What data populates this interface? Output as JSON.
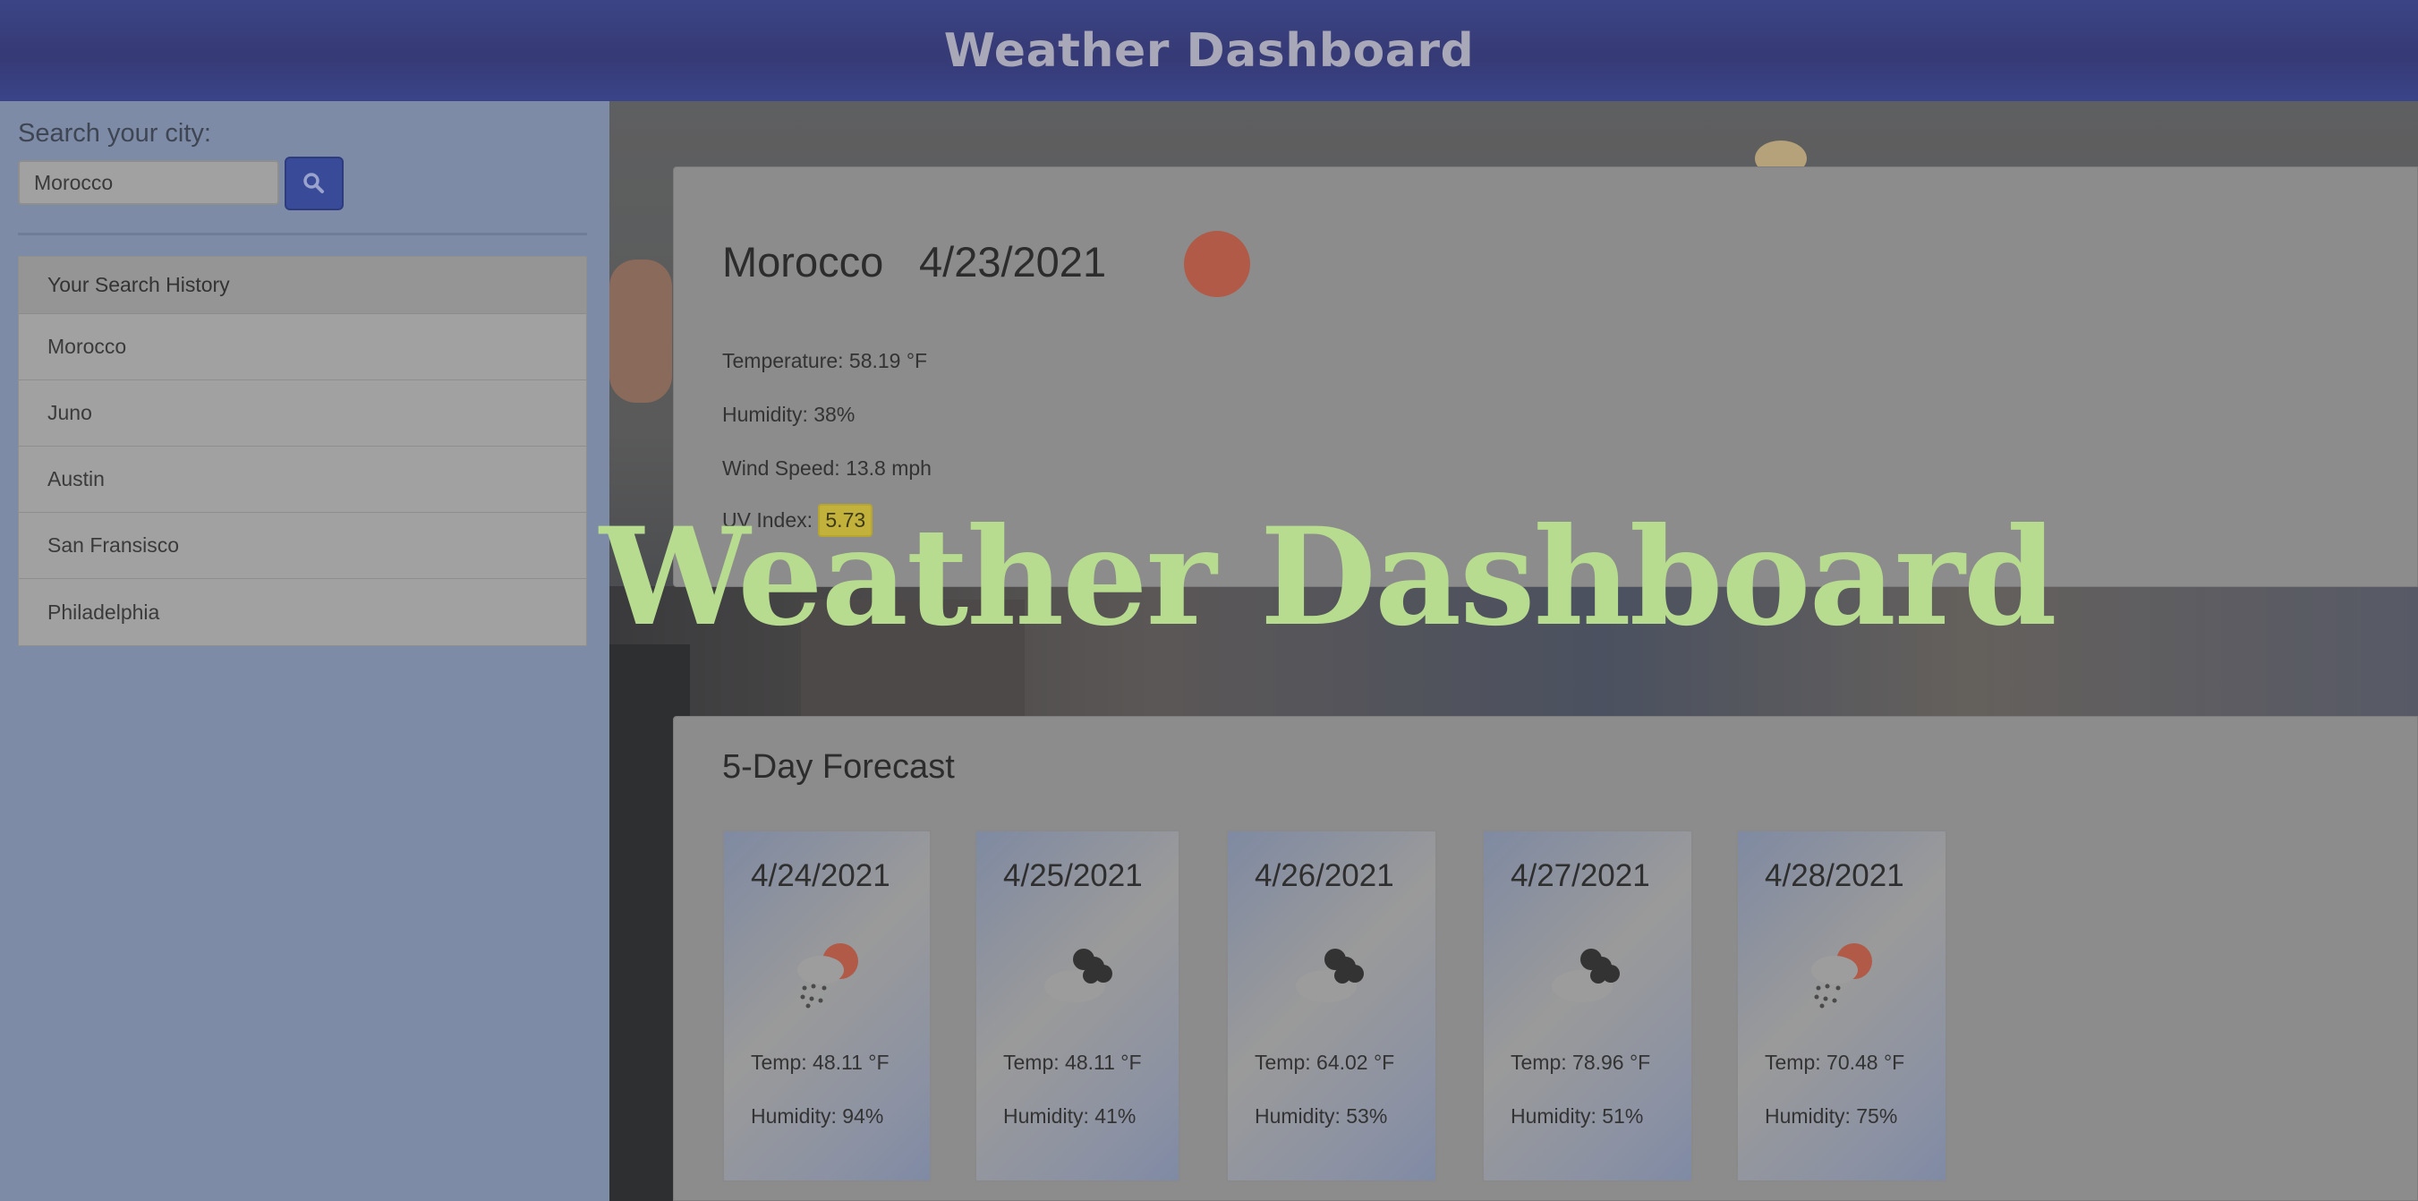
{
  "header": {
    "title": "Weather Dashboard"
  },
  "sidebar": {
    "search_label": "Search your city:",
    "search_value": "Morocco",
    "search_icon": "search-icon",
    "history_title": "Your Search History",
    "history": [
      "Morocco",
      "Juno",
      "Austin",
      "San Fransisco",
      "Philadelphia"
    ]
  },
  "current": {
    "city": "Morocco",
    "date": "4/23/2021",
    "icon": "sun-icon",
    "temperature": "Temperature: 58.19 °F",
    "humidity": "Humidity: 38%",
    "wind": "Wind Speed: 13.8 mph",
    "uv_label": "UV Index:",
    "uv_value": "5.73"
  },
  "forecast": {
    "title": "5-Day Forecast",
    "days": [
      {
        "date": "4/24/2021",
        "icon": "sun-rain-icon",
        "temp": "Temp: 48.11 °F",
        "humidity": "Humidity: 94%"
      },
      {
        "date": "4/25/2021",
        "icon": "dark-clouds-icon",
        "temp": "Temp: 48.11 °F",
        "humidity": "Humidity: 41%"
      },
      {
        "date": "4/26/2021",
        "icon": "dark-clouds-icon",
        "temp": "Temp: 64.02 °F",
        "humidity": "Humidity: 53%"
      },
      {
        "date": "4/27/2021",
        "icon": "dark-clouds-icon",
        "temp": "Temp: 78.96 °F",
        "humidity": "Humidity: 51%"
      },
      {
        "date": "4/28/2021",
        "icon": "sun-rain-icon",
        "temp": "Temp: 70.48 °F",
        "humidity": "Humidity: 75%"
      }
    ]
  },
  "overlay": {
    "title": "Weather Dashboard"
  },
  "colors": {
    "header": "#363a75",
    "sidebar": "#7d8ba6",
    "accent_button": "#384a98",
    "uv_badge": "#c2b13a",
    "overlay_text": "#b7dc8f"
  }
}
